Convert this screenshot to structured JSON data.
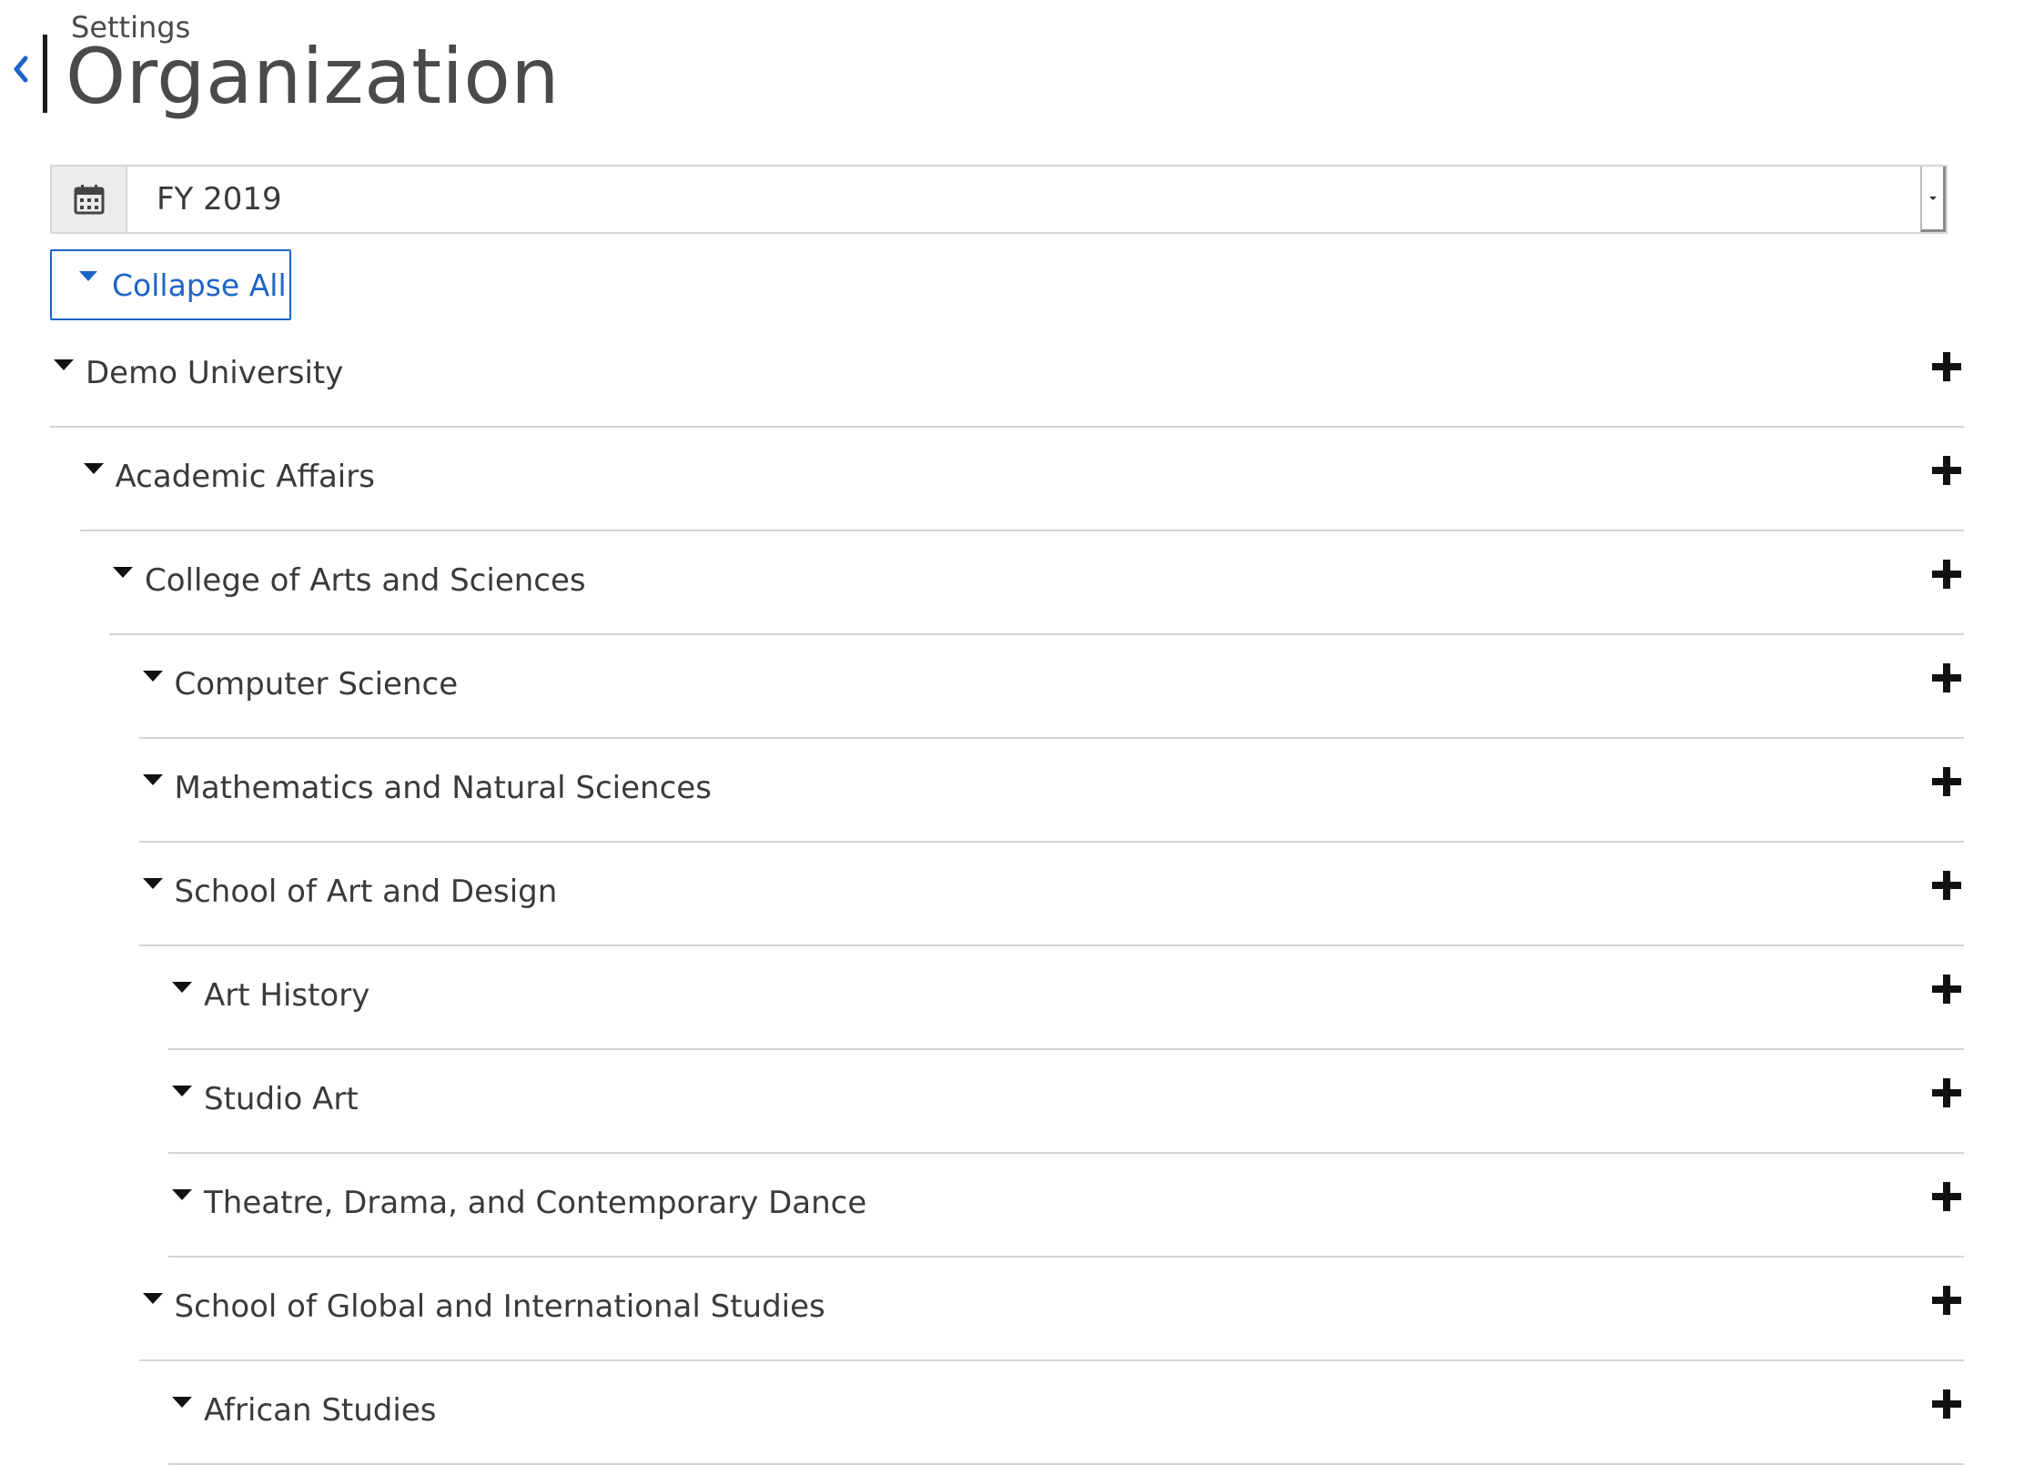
{
  "header": {
    "breadcrumb": "Settings",
    "title": "Organization",
    "back_icon": "chevron-left-icon"
  },
  "fiscal_year": {
    "icon": "calendar-icon",
    "selected": "FY 2019"
  },
  "collapse_all": {
    "label": "Collapse All",
    "icon": "caret-down-icon"
  },
  "colors": {
    "accent": "#1e64c8",
    "text": "#3a3a3a",
    "divider": "#d4d4d4"
  },
  "tree": [
    {
      "label": "Demo University",
      "level": 0,
      "expanded": true
    },
    {
      "label": "Academic Affairs",
      "level": 1,
      "expanded": true
    },
    {
      "label": "College of Arts and Sciences",
      "level": 2,
      "expanded": true
    },
    {
      "label": "Computer Science",
      "level": 3,
      "expanded": true
    },
    {
      "label": "Mathematics and Natural Sciences",
      "level": 3,
      "expanded": true
    },
    {
      "label": "School of Art and Design",
      "level": 3,
      "expanded": true
    },
    {
      "label": "Art History",
      "level": 4,
      "expanded": true
    },
    {
      "label": "Studio Art",
      "level": 4,
      "expanded": true
    },
    {
      "label": "Theatre, Drama, and Contemporary Dance",
      "level": 4,
      "expanded": true
    },
    {
      "label": "School of Global and International Studies",
      "level": 3,
      "expanded": true
    },
    {
      "label": "African Studies",
      "level": 4,
      "expanded": true
    }
  ]
}
